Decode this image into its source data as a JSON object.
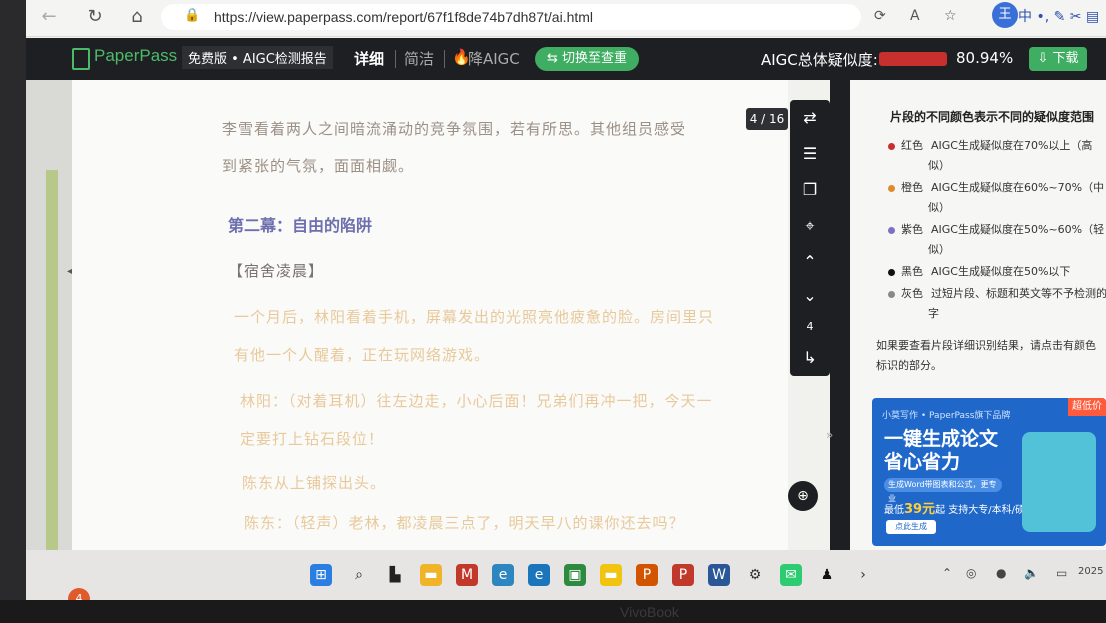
{
  "browser": {
    "url": "https://view.paperpass.com/report/67f1f8de74b7dh87t/ai.html",
    "back_icon": "back-arrow-icon",
    "reload_icon": "reload-icon",
    "home_icon": "home-icon",
    "profile_initial": "王",
    "ime_label": "中"
  },
  "header": {
    "brand": "PaperPass",
    "edition": "免费版 • AIGC检测报告",
    "tabs": [
      {
        "label": "详细",
        "active": true
      },
      {
        "label": "简洁",
        "active": false
      },
      {
        "label": "降AIGC",
        "active": false
      }
    ],
    "switch_label": "切换至查重",
    "score_label": "AIGC总体疑似度:",
    "score_value": "80.94%",
    "score_fraction": 0.8094,
    "download_label": "下载"
  },
  "document": {
    "page_indicator": "4 / 16",
    "paragraphs": [
      {
        "text_a": "李雪看着两人之间暗流涌动的竞争氛围，若有所思。其他组员感受",
        "style": "gray"
      },
      {
        "text_a": "到紧张的气氛，面面相觑。",
        "style": "gray"
      },
      {
        "text_a": "一个月后，林阳看着手机，屏幕发出的光照亮他疲惫的脸。房间里只",
        "style": "orange"
      },
      {
        "text_a": "有他一个人醒着，正在玩网络游戏。",
        "style": "orange"
      },
      {
        "text_a": "林阳：（对着耳机）往左边走，小心后面！兄弟们再冲一把，今天一",
        "style": "orange"
      },
      {
        "text_a": "定要打上钻石段位！",
        "style": "orange"
      },
      {
        "text_a": "陈东从上铺探出头。",
        "style": "orange"
      },
      {
        "text_a": "陈东：（轻声）老林，都凌晨三点了，明天早八的课你还去吗？",
        "style": "orange"
      }
    ],
    "act_title": "第二幕：自由的陷阱",
    "scene_heading": "【宿舍凌晨】",
    "toolbar_page": "4"
  },
  "legend": {
    "title": "片段的不同颜色表示不同的疑似度范围",
    "items": [
      {
        "name": "红色",
        "desc": "AIGC生成疑似度在70%以上（高",
        "desc2": "似）",
        "color": "#c7302c"
      },
      {
        "name": "橙色",
        "desc": "AIGC生成疑似度在60%~70%（中",
        "desc2": "似）",
        "color": "#e08a2f"
      },
      {
        "name": "紫色",
        "desc": "AIGC生成疑似度在50%~60%（轻",
        "desc2": "似）",
        "color": "#7b6fc6"
      },
      {
        "name": "黑色",
        "desc": "AIGC生成疑似度在50%以下",
        "desc2": "",
        "color": "#111111"
      },
      {
        "name": "灰色",
        "desc": "过短片段、标题和英文等不予检测的",
        "desc2": "字",
        "color": "#8a8a8a"
      }
    ],
    "hint": "如果要查看片段详细识别结果，请点击有颜色标识的部分。"
  },
  "ad": {
    "top": "小莫写作 • PaperPass旗下品牌",
    "badge": "超低价",
    "headline1": "一键生成论文",
    "headline2": "省心省力",
    "chip": "生成Word带图表和公式，更专业",
    "price_prefix": "最低",
    "price": "39元",
    "price_suffix": "起 支持大专/本科/硕士",
    "cta": "点此生成"
  },
  "taskbar": {
    "notification_count": "4",
    "year": "2025"
  },
  "bezel": {
    "brand": "VivoBook"
  }
}
